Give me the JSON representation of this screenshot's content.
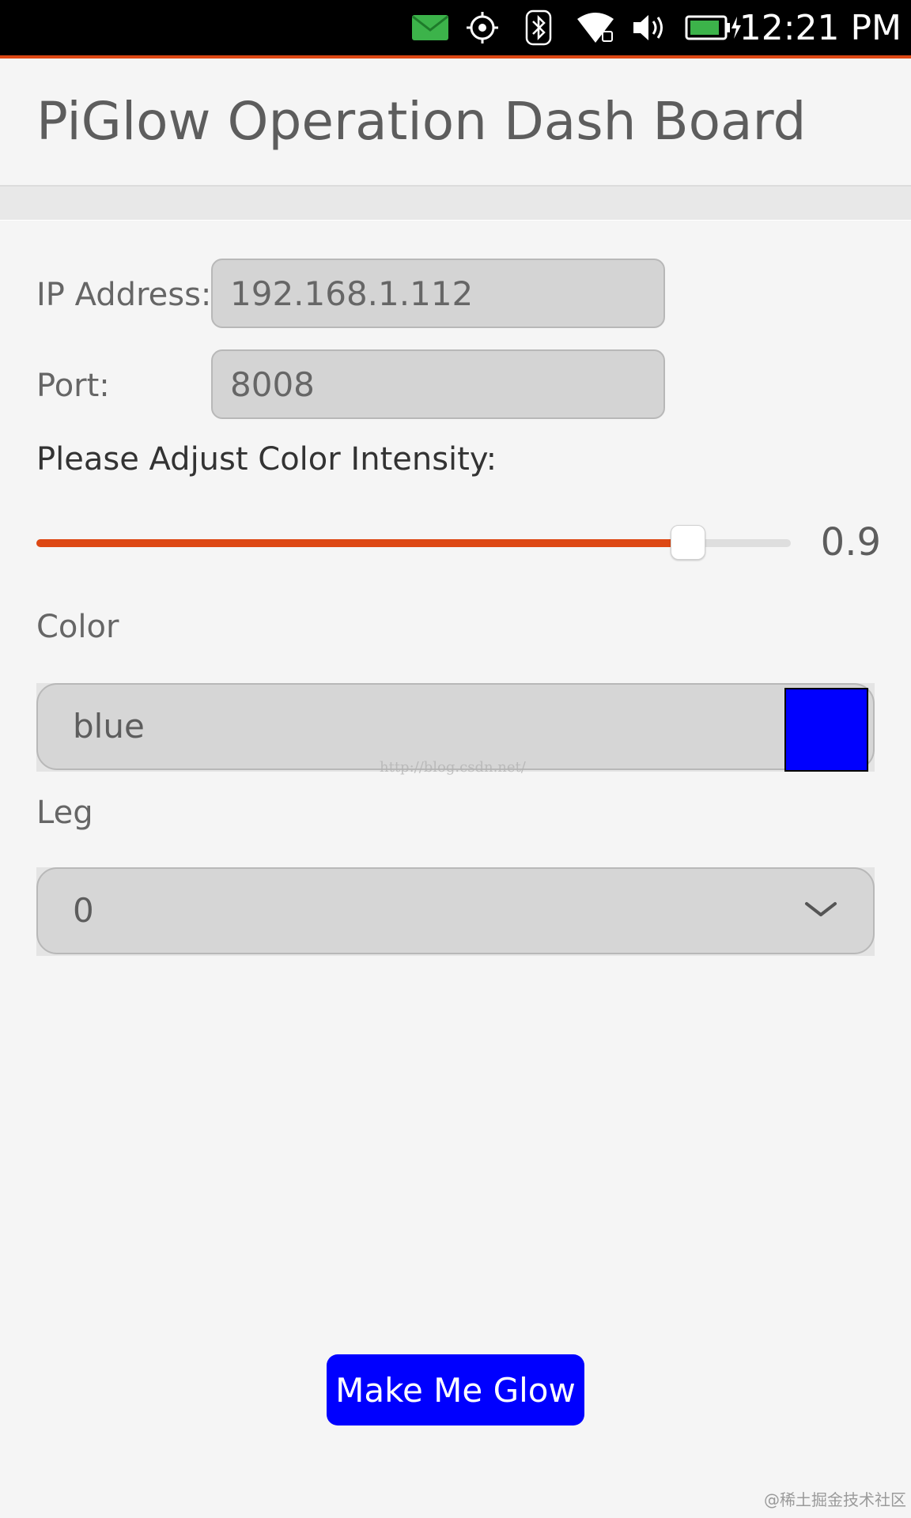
{
  "status_bar": {
    "icons": [
      "mail-icon",
      "location-icon",
      "bluetooth-icon",
      "wifi-icon",
      "volume-icon",
      "battery-icon"
    ],
    "time": "12:21 PM",
    "colors": {
      "background": "#000000",
      "mail": "#3cb34a",
      "accent_line": "#dd4814"
    }
  },
  "header": {
    "title": "PiGlow Operation Dash Board"
  },
  "form": {
    "ip_label": "IP Address:",
    "ip_value": "192.168.1.112",
    "port_label": "Port:",
    "port_value": "8008",
    "intensity_label": "Please Adjust Color Intensity:",
    "intensity": {
      "value": 0.9,
      "display": "0.9",
      "min": 0,
      "max": 1
    },
    "color_label": "Color",
    "color_value": "blue",
    "color_swatch": "#0000ff",
    "leg_label": "Leg",
    "leg_value": "0"
  },
  "watermark": "http://blog.csdn.net/",
  "button": {
    "label": "Make Me Glow",
    "color": "#0000ff"
  },
  "corner_watermark": "@稀土掘金技术社区",
  "theme": {
    "accent": "#dd4814",
    "background": "#f5f5f5"
  }
}
